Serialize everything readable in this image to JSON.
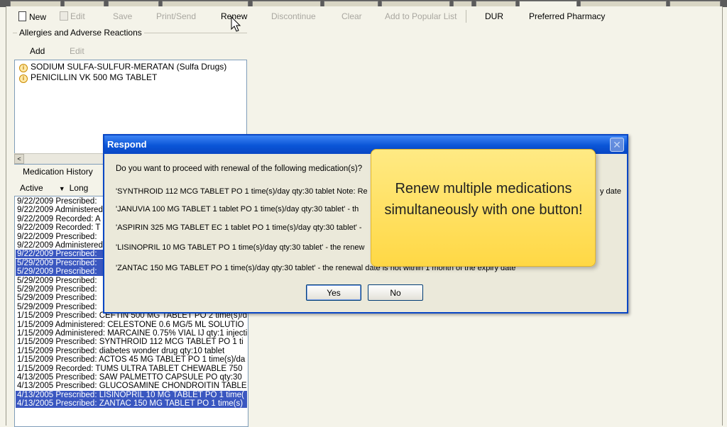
{
  "toolbar": {
    "new": "New",
    "edit": "Edit",
    "save": "Save",
    "print_send": "Print/Send",
    "renew": "Renew",
    "discontinue": "Discontinue",
    "clear": "Clear",
    "add_popular": "Add to Popular List",
    "dur": "DUR",
    "preferred_pharmacy": "Preferred Pharmacy"
  },
  "allergies": {
    "title": "Allergies and Adverse Reactions",
    "add": "Add",
    "edit": "Edit",
    "items": [
      "SODIUM SULFA-SULFUR-MERATAN (Sulfa Drugs)",
      "PENICILLIN VK 500 MG TABLET"
    ],
    "scroll_left": "<"
  },
  "med_history": {
    "title": "Medication History",
    "filter_value": "Active",
    "filter_arrow": "▼",
    "view_label": "Long",
    "rows": [
      "9/22/2009 Prescribed:",
      "9/22/2009 Administered",
      "9/22/2009 Recorded: A",
      "9/22/2009 Recorded: T",
      "9/22/2009 Prescribed:",
      "9/22/2009 Administered",
      "9/22/2009 Prescribed:",
      "5/29/2009 Prescribed:",
      "5/29/2009 Prescribed:",
      "5/29/2009 Prescribed:",
      "5/29/2009 Prescribed:",
      "5/29/2009 Prescribed:",
      "5/29/2009 Prescribed:",
      "1/15/2009 Prescribed: CEFTIN 500 MG TABLET PO 2 time(s)/d",
      "1/15/2009 Administered: CELESTONE 0.6 MG/5 ML SOLUTIO",
      "1/15/2009 Administered: MARCAINE 0.75% VIAL IJ qty:1 injecti",
      "1/15/2009 Prescribed: SYNTHROID 112 MCG TABLET PO 1 ti",
      "1/15/2009 Prescribed: diabetes wonder drug qty:10 tablet",
      "1/15/2009 Prescribed: ACTOS 45 MG TABLET PO 1 time(s)/da",
      "1/15/2009 Recorded: TUMS ULTRA TABLET CHEWABLE 750",
      "4/13/2005 Prescribed: SAW PALMETTO CAPSULE PO qty:30",
      "4/13/2005 Prescribed: GLUCOSAMINE CHONDROITIN TABLE",
      "4/13/2005 Prescribed: LISINOPRIL 10 MG TABLET PO 1 time(",
      "4/13/2005 Prescribed: ZANTAC 150 MG TABLET PO 1 time(s)"
    ]
  },
  "dialog": {
    "title": "Respond",
    "close": "✕",
    "question": "Do you want to proceed with renewal of the following medication(s)?",
    "lines": [
      "'SYNTHROID 112 MCG TABLET PO 1 time(s)/day qty:30 tablet Note: Re",
      "'JANUVIA 100 MG TABLET 1 tablet PO 1 time(s)/day qty:30 tablet' -  th",
      "'ASPIRIN 325 MG TABLET EC 1 tablet PO 1 time(s)/day qty:30 tablet' -",
      "'LISINOPRIL 10 MG TABLET PO 1 time(s)/day qty:30 tablet' -  the renew",
      "'ZANTAC 150 MG TABLET PO 1 time(s)/day qty:30 tablet' -  the renewal date is not within 1 month of the expiry date"
    ],
    "line1_tail": "y date",
    "yes": "Yes",
    "no": "No"
  },
  "callout": {
    "text": "Renew multiple medications simultaneously with one button!"
  }
}
